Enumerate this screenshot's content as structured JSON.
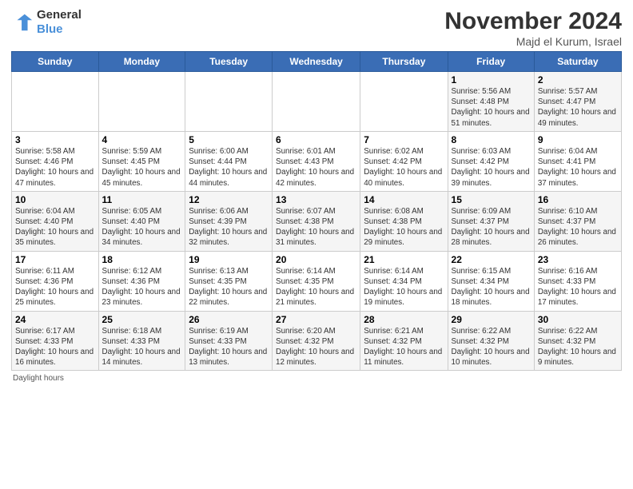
{
  "logo": {
    "line1": "General",
    "line2": "Blue"
  },
  "title": "November 2024",
  "location": "Majd el Kurum, Israel",
  "days_of_week": [
    "Sunday",
    "Monday",
    "Tuesday",
    "Wednesday",
    "Thursday",
    "Friday",
    "Saturday"
  ],
  "footer": "Daylight hours",
  "weeks": [
    [
      {
        "day": "",
        "info": ""
      },
      {
        "day": "",
        "info": ""
      },
      {
        "day": "",
        "info": ""
      },
      {
        "day": "",
        "info": ""
      },
      {
        "day": "",
        "info": ""
      },
      {
        "day": "1",
        "info": "Sunrise: 5:56 AM\nSunset: 4:48 PM\nDaylight: 10 hours and 51 minutes."
      },
      {
        "day": "2",
        "info": "Sunrise: 5:57 AM\nSunset: 4:47 PM\nDaylight: 10 hours and 49 minutes."
      }
    ],
    [
      {
        "day": "3",
        "info": "Sunrise: 5:58 AM\nSunset: 4:46 PM\nDaylight: 10 hours and 47 minutes."
      },
      {
        "day": "4",
        "info": "Sunrise: 5:59 AM\nSunset: 4:45 PM\nDaylight: 10 hours and 45 minutes."
      },
      {
        "day": "5",
        "info": "Sunrise: 6:00 AM\nSunset: 4:44 PM\nDaylight: 10 hours and 44 minutes."
      },
      {
        "day": "6",
        "info": "Sunrise: 6:01 AM\nSunset: 4:43 PM\nDaylight: 10 hours and 42 minutes."
      },
      {
        "day": "7",
        "info": "Sunrise: 6:02 AM\nSunset: 4:42 PM\nDaylight: 10 hours and 40 minutes."
      },
      {
        "day": "8",
        "info": "Sunrise: 6:03 AM\nSunset: 4:42 PM\nDaylight: 10 hours and 39 minutes."
      },
      {
        "day": "9",
        "info": "Sunrise: 6:04 AM\nSunset: 4:41 PM\nDaylight: 10 hours and 37 minutes."
      }
    ],
    [
      {
        "day": "10",
        "info": "Sunrise: 6:04 AM\nSunset: 4:40 PM\nDaylight: 10 hours and 35 minutes."
      },
      {
        "day": "11",
        "info": "Sunrise: 6:05 AM\nSunset: 4:40 PM\nDaylight: 10 hours and 34 minutes."
      },
      {
        "day": "12",
        "info": "Sunrise: 6:06 AM\nSunset: 4:39 PM\nDaylight: 10 hours and 32 minutes."
      },
      {
        "day": "13",
        "info": "Sunrise: 6:07 AM\nSunset: 4:38 PM\nDaylight: 10 hours and 31 minutes."
      },
      {
        "day": "14",
        "info": "Sunrise: 6:08 AM\nSunset: 4:38 PM\nDaylight: 10 hours and 29 minutes."
      },
      {
        "day": "15",
        "info": "Sunrise: 6:09 AM\nSunset: 4:37 PM\nDaylight: 10 hours and 28 minutes."
      },
      {
        "day": "16",
        "info": "Sunrise: 6:10 AM\nSunset: 4:37 PM\nDaylight: 10 hours and 26 minutes."
      }
    ],
    [
      {
        "day": "17",
        "info": "Sunrise: 6:11 AM\nSunset: 4:36 PM\nDaylight: 10 hours and 25 minutes."
      },
      {
        "day": "18",
        "info": "Sunrise: 6:12 AM\nSunset: 4:36 PM\nDaylight: 10 hours and 23 minutes."
      },
      {
        "day": "19",
        "info": "Sunrise: 6:13 AM\nSunset: 4:35 PM\nDaylight: 10 hours and 22 minutes."
      },
      {
        "day": "20",
        "info": "Sunrise: 6:14 AM\nSunset: 4:35 PM\nDaylight: 10 hours and 21 minutes."
      },
      {
        "day": "21",
        "info": "Sunrise: 6:14 AM\nSunset: 4:34 PM\nDaylight: 10 hours and 19 minutes."
      },
      {
        "day": "22",
        "info": "Sunrise: 6:15 AM\nSunset: 4:34 PM\nDaylight: 10 hours and 18 minutes."
      },
      {
        "day": "23",
        "info": "Sunrise: 6:16 AM\nSunset: 4:33 PM\nDaylight: 10 hours and 17 minutes."
      }
    ],
    [
      {
        "day": "24",
        "info": "Sunrise: 6:17 AM\nSunset: 4:33 PM\nDaylight: 10 hours and 16 minutes."
      },
      {
        "day": "25",
        "info": "Sunrise: 6:18 AM\nSunset: 4:33 PM\nDaylight: 10 hours and 14 minutes."
      },
      {
        "day": "26",
        "info": "Sunrise: 6:19 AM\nSunset: 4:33 PM\nDaylight: 10 hours and 13 minutes."
      },
      {
        "day": "27",
        "info": "Sunrise: 6:20 AM\nSunset: 4:32 PM\nDaylight: 10 hours and 12 minutes."
      },
      {
        "day": "28",
        "info": "Sunrise: 6:21 AM\nSunset: 4:32 PM\nDaylight: 10 hours and 11 minutes."
      },
      {
        "day": "29",
        "info": "Sunrise: 6:22 AM\nSunset: 4:32 PM\nDaylight: 10 hours and 10 minutes."
      },
      {
        "day": "30",
        "info": "Sunrise: 6:22 AM\nSunset: 4:32 PM\nDaylight: 10 hours and 9 minutes."
      }
    ]
  ]
}
